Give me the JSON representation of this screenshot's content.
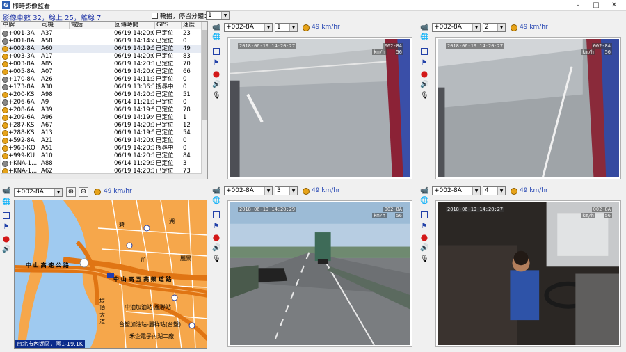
{
  "window": {
    "title": "即時影像監看",
    "app_icon": "G"
  },
  "summary": {
    "label_count": "影像車數",
    "count": "32",
    "label_online": "線上",
    "online": "25",
    "label_offline": "離線",
    "offline": "7"
  },
  "broadcast": {
    "label": "輪播，停留分鐘：",
    "value": "1"
  },
  "table": {
    "columns": [
      "車牌",
      "司機",
      "電話",
      "回傳時間",
      "GPS",
      "速度"
    ],
    "rows": [
      {
        "plate": "+001-3A",
        "driver": "A37",
        "phone": "",
        "time": "06/19 14:20:05",
        "gps": "已定位",
        "speed": "23",
        "icon": "gray"
      },
      {
        "plate": "+001-8A",
        "driver": "A58",
        "phone": "",
        "time": "06/19 14:14:41",
        "gps": "已定位",
        "speed": "0",
        "icon": "gray"
      },
      {
        "plate": "+002-8A",
        "driver": "A60",
        "phone": "",
        "time": "06/19 14:19:59",
        "gps": "已定位",
        "speed": "49",
        "icon": "yellow",
        "selected": true
      },
      {
        "plate": "+003-3A",
        "driver": "A17",
        "phone": "",
        "time": "06/19 14:20:04",
        "gps": "已定位",
        "speed": "83",
        "icon": "yellow"
      },
      {
        "plate": "+003-8A",
        "driver": "A85",
        "phone": "",
        "time": "06/19 14:20:10",
        "gps": "已定位",
        "speed": "70",
        "icon": "yellow"
      },
      {
        "plate": "+005-8A",
        "driver": "A07",
        "phone": "",
        "time": "06/19 14:20:09",
        "gps": "已定位",
        "speed": "66",
        "icon": "yellow"
      },
      {
        "plate": "+170-8A",
        "driver": "A26",
        "phone": "",
        "time": "06/19 14:11:33",
        "gps": "已定位",
        "speed": "0",
        "icon": "gray"
      },
      {
        "plate": "+173-8A",
        "driver": "A30",
        "phone": "",
        "time": "06/19 13:36:32",
        "gps": "搜尋中",
        "speed": "0",
        "icon": "gray"
      },
      {
        "plate": "+200-KS",
        "driver": "A98",
        "phone": "",
        "time": "06/19 14:20:13",
        "gps": "已定位",
        "speed": "51",
        "icon": "yellow"
      },
      {
        "plate": "+206-6A",
        "driver": "A9",
        "phone": "",
        "time": "06/14 11:21:10",
        "gps": "已定位",
        "speed": "0",
        "icon": "gray"
      },
      {
        "plate": "+208-6A",
        "driver": "A39",
        "phone": "",
        "time": "06/19 14:19:59",
        "gps": "已定位",
        "speed": "78",
        "icon": "yellow"
      },
      {
        "plate": "+209-6A",
        "driver": "A96",
        "phone": "",
        "time": "06/19 14:19:49",
        "gps": "已定位",
        "speed": "1",
        "icon": "yellow"
      },
      {
        "plate": "+287-KS",
        "driver": "A67",
        "phone": "",
        "time": "06/19 14:20:13",
        "gps": "已定位",
        "speed": "12",
        "icon": "yellow"
      },
      {
        "plate": "+288-KS",
        "driver": "A13",
        "phone": "",
        "time": "06/19 14:19:58",
        "gps": "已定位",
        "speed": "54",
        "icon": "yellow"
      },
      {
        "plate": "+592-8A",
        "driver": "A21",
        "phone": "",
        "time": "06/19 14:20:08",
        "gps": "已定位",
        "speed": "0",
        "icon": "yellow"
      },
      {
        "plate": "+963-KQ",
        "driver": "A51",
        "phone": "",
        "time": "06/19 14:20:15",
        "gps": "搜尋中",
        "speed": "0",
        "icon": "yellow"
      },
      {
        "plate": "+999-KU",
        "driver": "A10",
        "phone": "",
        "time": "06/19 14:20:11",
        "gps": "已定位",
        "speed": "84",
        "icon": "yellow"
      },
      {
        "plate": "+KNA-1...",
        "driver": "A88",
        "phone": "",
        "time": "06/14 11:29:39",
        "gps": "已定位",
        "speed": "3",
        "icon": "gray"
      },
      {
        "plate": "+KNA-1...",
        "driver": "A62",
        "phone": "",
        "time": "06/19 14:20:18",
        "gps": "已定位",
        "speed": "73",
        "icon": "yellow"
      }
    ]
  },
  "panels": [
    {
      "vehicle": "+002-8A",
      "channel": "1",
      "speed": "49 km/hr",
      "osd_time": "2018-06-19 14:20:27",
      "osd_plate": "002-8A",
      "osd_speed_unit": "km/h",
      "osd_speed": "56"
    },
    {
      "vehicle": "+002-8A",
      "channel": "2",
      "speed": "49 km/hr",
      "osd_time": "2018-06-19 14:20:27",
      "osd_plate": "002-8A",
      "osd_speed_unit": "km/h",
      "osd_speed": "56"
    },
    {
      "vehicle": "+002-8A",
      "channel": "3",
      "speed": "49 km/hr",
      "osd_time": "2018-06-19 14:20:29",
      "osd_plate": "002-8A",
      "osd_speed_unit": "km/h",
      "osd_speed": "56"
    },
    {
      "vehicle": "+002-8A",
      "channel": "4",
      "speed": "49 km/hr",
      "osd_time": "2018-06-19 14:20:27",
      "osd_plate": "002-8A",
      "osd_speed_unit": "km/h",
      "osd_speed": "56"
    }
  ],
  "map": {
    "vehicle": "+002-8A",
    "speed": "49 km/hr",
    "status": "台北市內湖區，國1-19.1K",
    "labels": {
      "road1": "中 山 高 速 公 路",
      "road2": "中 山 高 五 高 架 道 路",
      "gas1": "中油加油站-麗聯站",
      "gas2": "台塑加油站-麗祥站(台塑)",
      "plant": "禾企電子內湖二廠",
      "dist1": "碧",
      "dist2": "湖",
      "dist3": "麗",
      "dist4": "山",
      "dist5": "麗山",
      "dist6": "麗景",
      "dist7": "湖",
      "dist8": "光",
      "park": "公園",
      "area1": "堤",
      "area2": "頂",
      "area3": "大",
      "area4": "道"
    },
    "colors": {
      "land": "#f5a64a",
      "water": "#9ecbf0",
      "road": "#e07a14",
      "highway": "#f07d1f"
    }
  },
  "icons": [
    "camera-icon",
    "globe-icon",
    "target-icon",
    "flag-icon",
    "record-icon",
    "speaker-icon",
    "mic-icon",
    "zoom-in-icon",
    "zoom-out-icon",
    "speed-icon"
  ]
}
